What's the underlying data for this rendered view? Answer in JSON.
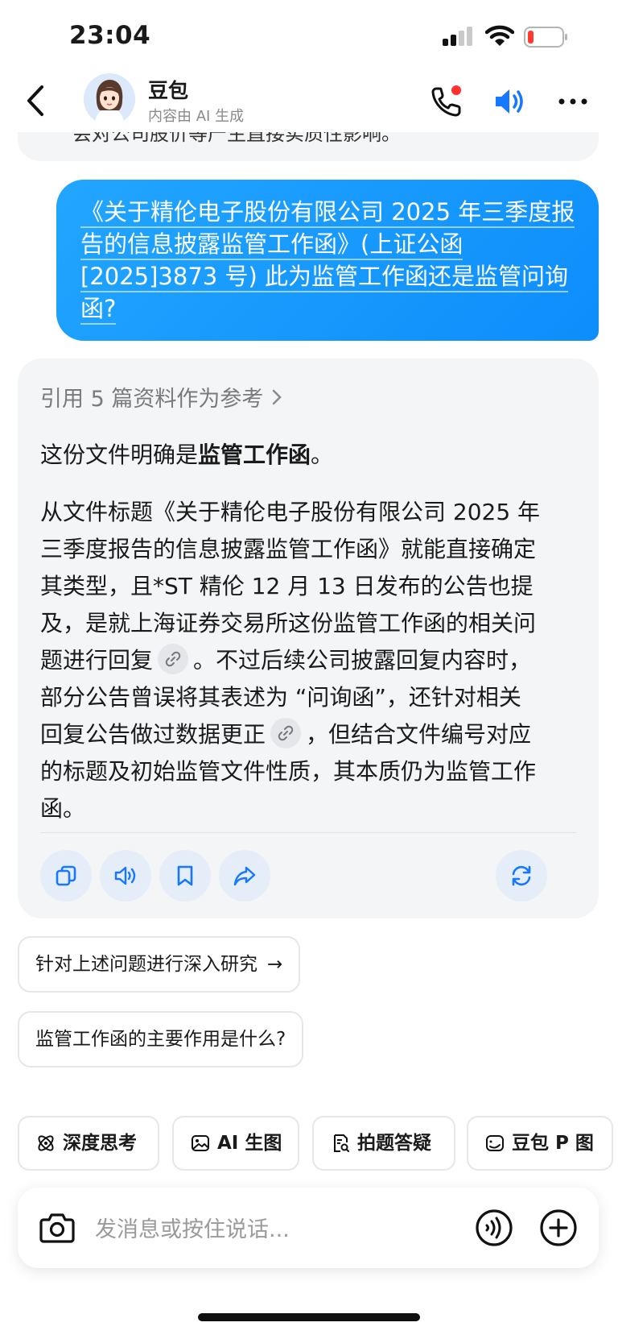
{
  "status_bar": {
    "time": "23:04",
    "battery_color": "#ff3b30"
  },
  "header": {
    "bot_name": "豆包",
    "bot_subtitle": "内容由 AI 生成",
    "call_badge_color": "#ff3030",
    "accent": "#1677ff",
    "icons": [
      "back-icon",
      "avatar",
      "phone-call-icon",
      "speaker-icon",
      "more-icon"
    ]
  },
  "previous_message": {
    "text": "会对公司股价等产生直接实质性影响。"
  },
  "user_message": {
    "lines": [
      "《关于精伦电子股份有限公司 2025 年三季度报",
      "告的信息披露监管工作函》(上证公函",
      "[2025]3873 号) 此为监管工作函还是监管问询",
      "函?"
    ],
    "bubble_color": "#1a9bff"
  },
  "answer": {
    "references": "引用 5 篇资料作为参考",
    "lead_prefix": "这份文件明确是",
    "lead_bold": "监管工作函",
    "lead_suffix": "。",
    "body_lines": [
      "从文件标题《关于精伦电子股份有限公司 2025 年",
      "三季度报告的信息披露监管工作函》就能直接确定",
      "其类型，且*ST 精伦 12 月 13 日发布的公告也提",
      "及，是就上海证券交易所这份监管工作函的相关问",
      "题进行回复",
      "。不过后续公司披露回复内容时，",
      "部分公告曾误将其表述为 “问询函”，还针对相关",
      "回复公告做过数据更正",
      "，但结合文件编号对应",
      "的标题及初始监管文件性质，其本质仍为监管工作",
      "函。"
    ],
    "action_icons": [
      "copy-icon",
      "read-aloud-icon",
      "bookmark-icon",
      "share-icon",
      "regenerate-icon"
    ]
  },
  "suggestions": [
    {
      "label": "针对上述问题进行深入研究",
      "arrow": "→"
    },
    {
      "label": "监管工作函的主要作用是什么?"
    }
  ],
  "tools": [
    {
      "label": "深度思考",
      "icon": "atom-icon"
    },
    {
      "label": "AI 生图",
      "icon": "image-icon"
    },
    {
      "label": "拍题答疑",
      "icon": "doc-search-icon"
    },
    {
      "label": "豆包 P 图",
      "icon": "photo-edit-icon"
    }
  ],
  "input": {
    "placeholder": "发消息或按住说话..."
  }
}
